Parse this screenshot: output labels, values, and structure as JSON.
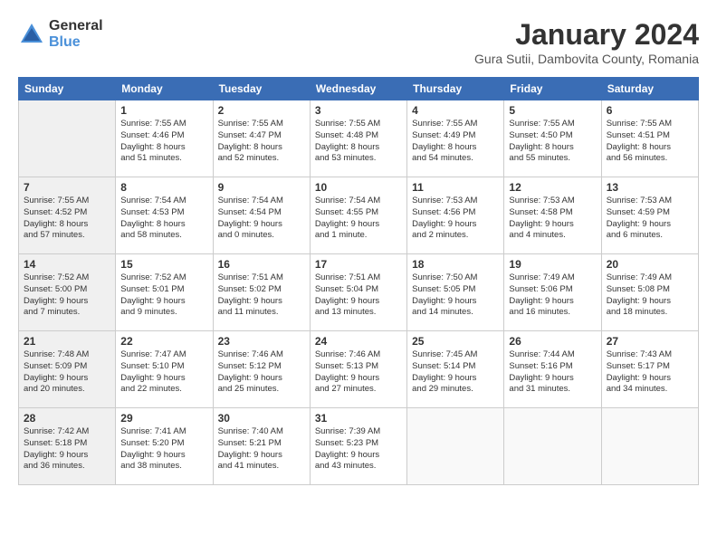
{
  "logo": {
    "general": "General",
    "blue": "Blue"
  },
  "title": "January 2024",
  "location": "Gura Sutii, Dambovita County, Romania",
  "weekdays": [
    "Sunday",
    "Monday",
    "Tuesday",
    "Wednesday",
    "Thursday",
    "Friday",
    "Saturday"
  ],
  "weeks": [
    [
      {
        "day": "",
        "info": ""
      },
      {
        "day": "1",
        "info": "Sunrise: 7:55 AM\nSunset: 4:46 PM\nDaylight: 8 hours\nand 51 minutes."
      },
      {
        "day": "2",
        "info": "Sunrise: 7:55 AM\nSunset: 4:47 PM\nDaylight: 8 hours\nand 52 minutes."
      },
      {
        "day": "3",
        "info": "Sunrise: 7:55 AM\nSunset: 4:48 PM\nDaylight: 8 hours\nand 53 minutes."
      },
      {
        "day": "4",
        "info": "Sunrise: 7:55 AM\nSunset: 4:49 PM\nDaylight: 8 hours\nand 54 minutes."
      },
      {
        "day": "5",
        "info": "Sunrise: 7:55 AM\nSunset: 4:50 PM\nDaylight: 8 hours\nand 55 minutes."
      },
      {
        "day": "6",
        "info": "Sunrise: 7:55 AM\nSunset: 4:51 PM\nDaylight: 8 hours\nand 56 minutes."
      }
    ],
    [
      {
        "day": "7",
        "info": "Sunrise: 7:55 AM\nSunset: 4:52 PM\nDaylight: 8 hours\nand 57 minutes."
      },
      {
        "day": "8",
        "info": "Sunrise: 7:54 AM\nSunset: 4:53 PM\nDaylight: 8 hours\nand 58 minutes."
      },
      {
        "day": "9",
        "info": "Sunrise: 7:54 AM\nSunset: 4:54 PM\nDaylight: 9 hours\nand 0 minutes."
      },
      {
        "day": "10",
        "info": "Sunrise: 7:54 AM\nSunset: 4:55 PM\nDaylight: 9 hours\nand 1 minute."
      },
      {
        "day": "11",
        "info": "Sunrise: 7:53 AM\nSunset: 4:56 PM\nDaylight: 9 hours\nand 2 minutes."
      },
      {
        "day": "12",
        "info": "Sunrise: 7:53 AM\nSunset: 4:58 PM\nDaylight: 9 hours\nand 4 minutes."
      },
      {
        "day": "13",
        "info": "Sunrise: 7:53 AM\nSunset: 4:59 PM\nDaylight: 9 hours\nand 6 minutes."
      }
    ],
    [
      {
        "day": "14",
        "info": "Sunrise: 7:52 AM\nSunset: 5:00 PM\nDaylight: 9 hours\nand 7 minutes."
      },
      {
        "day": "15",
        "info": "Sunrise: 7:52 AM\nSunset: 5:01 PM\nDaylight: 9 hours\nand 9 minutes."
      },
      {
        "day": "16",
        "info": "Sunrise: 7:51 AM\nSunset: 5:02 PM\nDaylight: 9 hours\nand 11 minutes."
      },
      {
        "day": "17",
        "info": "Sunrise: 7:51 AM\nSunset: 5:04 PM\nDaylight: 9 hours\nand 13 minutes."
      },
      {
        "day": "18",
        "info": "Sunrise: 7:50 AM\nSunset: 5:05 PM\nDaylight: 9 hours\nand 14 minutes."
      },
      {
        "day": "19",
        "info": "Sunrise: 7:49 AM\nSunset: 5:06 PM\nDaylight: 9 hours\nand 16 minutes."
      },
      {
        "day": "20",
        "info": "Sunrise: 7:49 AM\nSunset: 5:08 PM\nDaylight: 9 hours\nand 18 minutes."
      }
    ],
    [
      {
        "day": "21",
        "info": "Sunrise: 7:48 AM\nSunset: 5:09 PM\nDaylight: 9 hours\nand 20 minutes."
      },
      {
        "day": "22",
        "info": "Sunrise: 7:47 AM\nSunset: 5:10 PM\nDaylight: 9 hours\nand 22 minutes."
      },
      {
        "day": "23",
        "info": "Sunrise: 7:46 AM\nSunset: 5:12 PM\nDaylight: 9 hours\nand 25 minutes."
      },
      {
        "day": "24",
        "info": "Sunrise: 7:46 AM\nSunset: 5:13 PM\nDaylight: 9 hours\nand 27 minutes."
      },
      {
        "day": "25",
        "info": "Sunrise: 7:45 AM\nSunset: 5:14 PM\nDaylight: 9 hours\nand 29 minutes."
      },
      {
        "day": "26",
        "info": "Sunrise: 7:44 AM\nSunset: 5:16 PM\nDaylight: 9 hours\nand 31 minutes."
      },
      {
        "day": "27",
        "info": "Sunrise: 7:43 AM\nSunset: 5:17 PM\nDaylight: 9 hours\nand 34 minutes."
      }
    ],
    [
      {
        "day": "28",
        "info": "Sunrise: 7:42 AM\nSunset: 5:18 PM\nDaylight: 9 hours\nand 36 minutes."
      },
      {
        "day": "29",
        "info": "Sunrise: 7:41 AM\nSunset: 5:20 PM\nDaylight: 9 hours\nand 38 minutes."
      },
      {
        "day": "30",
        "info": "Sunrise: 7:40 AM\nSunset: 5:21 PM\nDaylight: 9 hours\nand 41 minutes."
      },
      {
        "day": "31",
        "info": "Sunrise: 7:39 AM\nSunset: 5:23 PM\nDaylight: 9 hours\nand 43 minutes."
      },
      {
        "day": "",
        "info": ""
      },
      {
        "day": "",
        "info": ""
      },
      {
        "day": "",
        "info": ""
      }
    ]
  ]
}
